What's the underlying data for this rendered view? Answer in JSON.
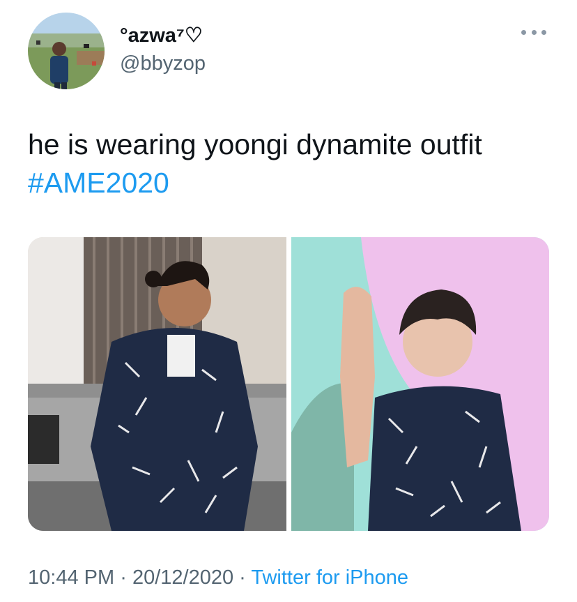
{
  "user": {
    "display_name": "°azwa⁷♡",
    "handle": "@bbyzop",
    "avatar": "profile-photo"
  },
  "tweet": {
    "text": "he is wearing yoongi dynamite outfit",
    "hashtag": "#AME2020"
  },
  "media": {
    "count": 2,
    "items": [
      "photo-man-patterned-outfit",
      "photo-yoongi-patterned-outfit"
    ]
  },
  "footer": {
    "time": "10:44 PM",
    "separator": "·",
    "date": "20/12/2020",
    "source": "Twitter for iPhone"
  },
  "colors": {
    "link": "#1d9bf0",
    "secondary_text": "#536471",
    "primary_text": "#0f1419",
    "icon_gray": "#8b98a5"
  },
  "icons": {
    "more": "more-dots-icon"
  }
}
